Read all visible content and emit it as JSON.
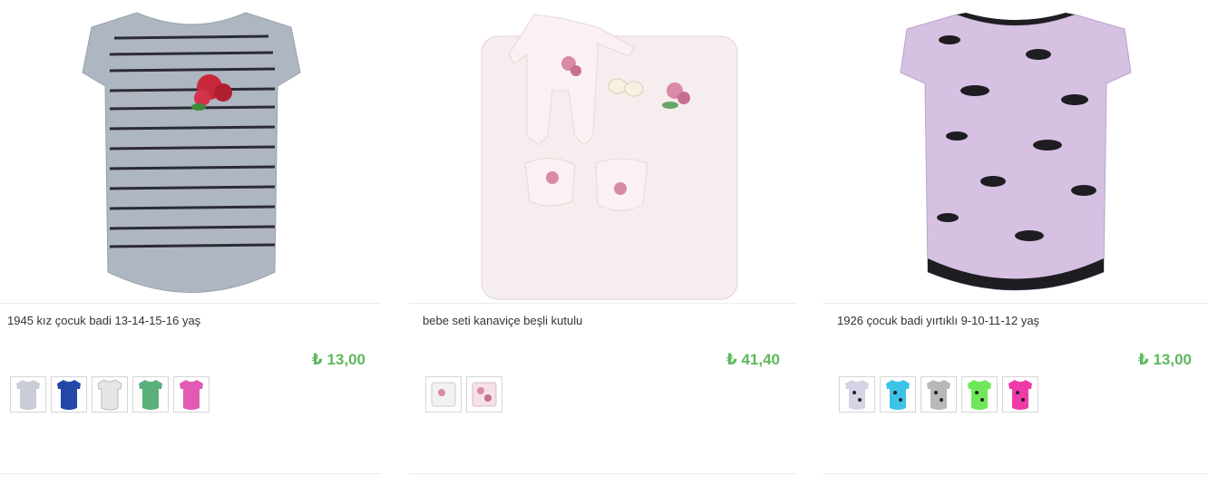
{
  "products": [
    {
      "name": "1945 kız çocuk badi 13-14-15-16 yaş",
      "price": "₺ 13,00",
      "image": "grey-printed-tshirt",
      "variants": [
        {
          "color": "#c9ced6",
          "icon": "grey-shirt-icon"
        },
        {
          "color": "#2447a8",
          "icon": "blue-shirt-icon"
        },
        {
          "color": "#e6e6e6",
          "icon": "white-shirt-icon"
        },
        {
          "color": "#5ab07a",
          "icon": "green-shirt-icon"
        },
        {
          "color": "#e35ab5",
          "icon": "pink-shirt-icon"
        }
      ]
    },
    {
      "name": "bebe seti kanaviçe beşli kutulu",
      "price": "₺ 41,40",
      "image": "baby-set",
      "variants": [
        {
          "color": "#f2f2f2",
          "icon": "white-set-icon"
        },
        {
          "color": "#f5e1e6",
          "icon": "pink-set-icon"
        }
      ]
    },
    {
      "name": "1926 çocuk badi yırtıklı 9-10-11-12 yaş",
      "price": "₺ 13,00",
      "image": "pink-patterned-tshirt",
      "variants": [
        {
          "color": "#d6d3e6",
          "icon": "lilac-shirt-icon"
        },
        {
          "color": "#3cc3e6",
          "icon": "turquoise-shirt-icon"
        },
        {
          "color": "#b8b8b8",
          "icon": "grey-shirt-icon"
        },
        {
          "color": "#6ee85a",
          "icon": "green-shirt-icon"
        },
        {
          "color": "#f03aa8",
          "icon": "pink-shirt-icon"
        }
      ]
    }
  ],
  "colors": {
    "price": "#5cb85c",
    "separator": "#ececec"
  }
}
